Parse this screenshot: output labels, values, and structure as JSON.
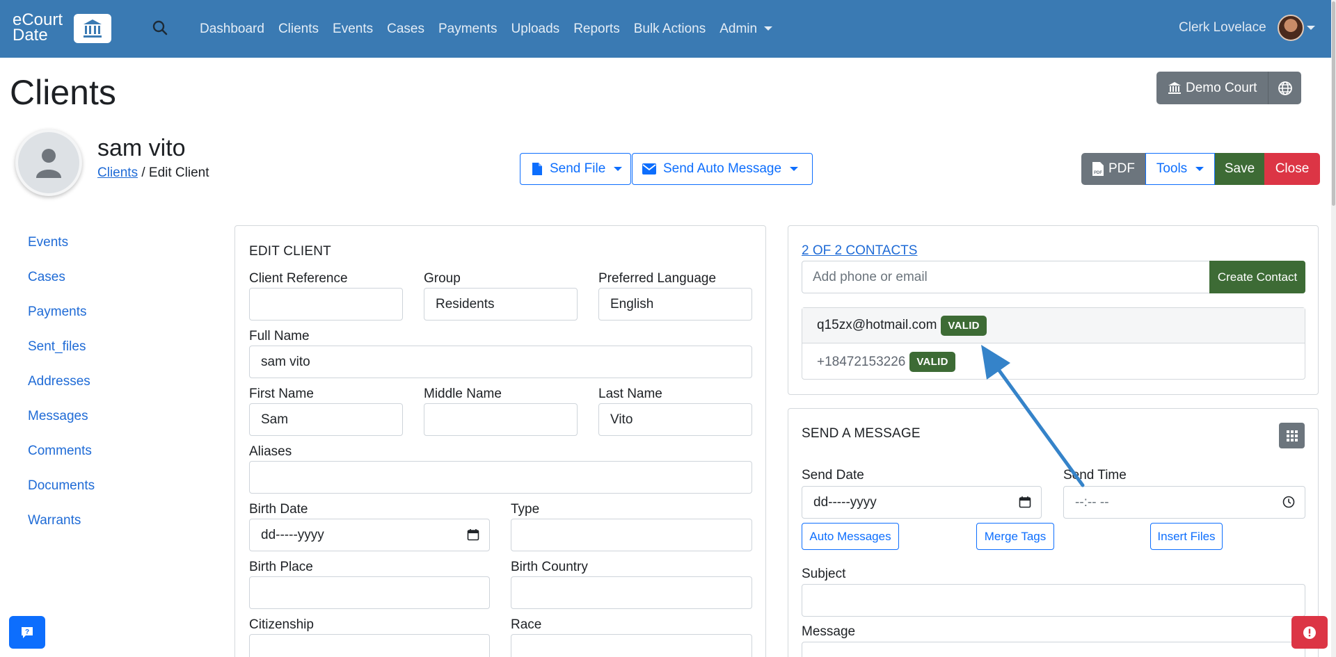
{
  "navbar": {
    "logo_line1": "eCourt",
    "logo_line2": "Date",
    "links": [
      "Dashboard",
      "Clients",
      "Events",
      "Cases",
      "Payments",
      "Uploads",
      "Reports",
      "Bulk Actions",
      "Admin"
    ],
    "user": "Clerk Lovelace"
  },
  "header": {
    "title": "Clients",
    "court_label": "Demo Court",
    "client_name": "sam vito",
    "breadcrumb_link": "Clients",
    "breadcrumb_rest": " / Edit Client",
    "send_file": "Send File",
    "send_auto": "Send Auto Message",
    "pdf": "PDF",
    "tools": "Tools",
    "save": "Save",
    "close": "Close"
  },
  "sidebar": {
    "items": [
      "Events",
      "Cases",
      "Payments",
      "Sent_files",
      "Addresses",
      "Messages",
      "Comments",
      "Documents",
      "Warrants"
    ]
  },
  "edit_client": {
    "title": "EDIT CLIENT",
    "client_reference_label": "Client Reference",
    "client_reference_value": "",
    "group_label": "Group",
    "group_value": "Residents",
    "language_label": "Preferred Language",
    "language_value": "English",
    "full_name_label": "Full Name",
    "full_name_value": "sam vito",
    "first_name_label": "First Name",
    "first_name_value": "Sam",
    "middle_name_label": "Middle Name",
    "middle_name_value": "",
    "last_name_label": "Last Name",
    "last_name_value": "Vito",
    "aliases_label": "Aliases",
    "birth_date_label": "Birth Date",
    "birth_date_value": "dd-----yyyy",
    "type_label": "Type",
    "birth_place_label": "Birth Place",
    "birth_country_label": "Birth Country",
    "citizenship_label": "Citizenship",
    "race_label": "Race"
  },
  "contacts": {
    "link": "2 OF 2 CONTACTS",
    "placeholder": "Add phone or email",
    "create": "Create Contact",
    "items": [
      {
        "value": "q15zx@hotmail.com",
        "status": "VALID"
      },
      {
        "value": "+18472153226",
        "status": "VALID"
      }
    ]
  },
  "send_message": {
    "title": "SEND A MESSAGE",
    "send_date_label": "Send Date",
    "send_date_value": "dd-----yyyy",
    "send_time_label": "Send Time",
    "send_time_value": "--:-- --",
    "auto_messages": "Auto Messages",
    "merge_tags": "Merge Tags",
    "insert_files": "Insert Files",
    "subject_label": "Subject",
    "message_label": "Message"
  },
  "colors": {
    "navbar": "#3a7ab3",
    "primary": "#0d6efd",
    "success": "#3d6b35",
    "danger": "#dc3545",
    "secondary": "#6c757d",
    "annotation_arrow": "#3583c9"
  },
  "icons": [
    "search-icon",
    "courthouse-icon",
    "globe-icon",
    "user-silhouette-icon",
    "file-icon",
    "envelope-icon",
    "pdf-icon",
    "calendar-icon",
    "clock-icon",
    "grid-icon",
    "help-chat-icon",
    "alert-icon"
  ]
}
